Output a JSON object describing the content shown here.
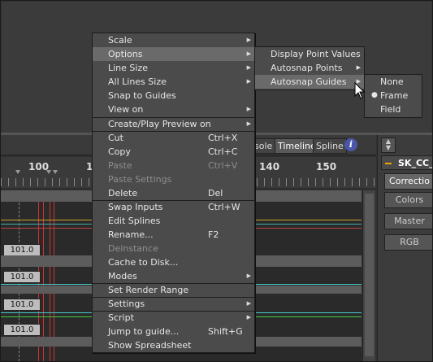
{
  "tabs": [
    {
      "label": "sole",
      "active": false
    },
    {
      "label": "Timeline",
      "active": true
    },
    {
      "label": "Spline",
      "active": false
    }
  ],
  "ruler": {
    "labels": [
      "100",
      "1",
      "140",
      "150"
    ]
  },
  "track_values": [
    "101.0",
    "101.0",
    "101.0",
    "101.0"
  ],
  "right_panel": {
    "header": "SK_CC_",
    "buttons": [
      "Correctio",
      "Colors",
      "Master",
      "RGB"
    ]
  },
  "menu": {
    "items": [
      {
        "label": "Scale",
        "submenu": true
      },
      {
        "label": "Options",
        "submenu": true,
        "highlight": true
      },
      {
        "label": "Line Size",
        "submenu": true
      },
      {
        "label": "All Lines Size",
        "submenu": true
      },
      {
        "label": "Snap to Guides"
      },
      {
        "label": "View on",
        "submenu": true
      },
      {
        "label": "Create/Play Preview on",
        "submenu": true
      },
      {
        "label": "Cut",
        "shortcut": "Ctrl+X"
      },
      {
        "label": "Copy",
        "shortcut": "Ctrl+C"
      },
      {
        "label": "Paste",
        "shortcut": "Ctrl+V",
        "disabled": true
      },
      {
        "label": "Paste Settings",
        "disabled": true
      },
      {
        "label": "Delete",
        "shortcut": "Del"
      },
      {
        "label": "Swap Inputs",
        "shortcut": "Ctrl+W"
      },
      {
        "label": "Edit Splines"
      },
      {
        "label": "Rename...",
        "shortcut": "F2"
      },
      {
        "label": "Deinstance",
        "disabled": true
      },
      {
        "label": "Cache to Disk..."
      },
      {
        "label": "Modes",
        "submenu": true
      },
      {
        "label": "Set Render Range"
      },
      {
        "label": "Settings",
        "submenu": true
      },
      {
        "label": "Script",
        "submenu": true
      },
      {
        "label": "Jump to guide...",
        "shortcut": "Shift+G"
      },
      {
        "label": "Show Spreadsheet"
      }
    ]
  },
  "options_submenu": {
    "items": [
      {
        "label": "Display Point Values"
      },
      {
        "label": "Autosnap Points",
        "submenu": true
      },
      {
        "label": "Autosnap Guides",
        "submenu": true,
        "highlight": true
      }
    ]
  },
  "autosnap_guides_submenu": {
    "items": [
      {
        "label": "None"
      },
      {
        "label": "Frame",
        "checked": true
      },
      {
        "label": "Field"
      }
    ]
  },
  "icons": {
    "info": "info-icon",
    "submenu_arrow": "triangle-right-icon",
    "panel_arrows": "up-down-arrows-icon",
    "cursor": "mouse-pointer-icon"
  },
  "colors": {
    "menu_bg": "#4b4b4b",
    "highlight": "#6a6a6a",
    "accent_orange": "#f0a000",
    "info_blue": "#4a57a8"
  }
}
